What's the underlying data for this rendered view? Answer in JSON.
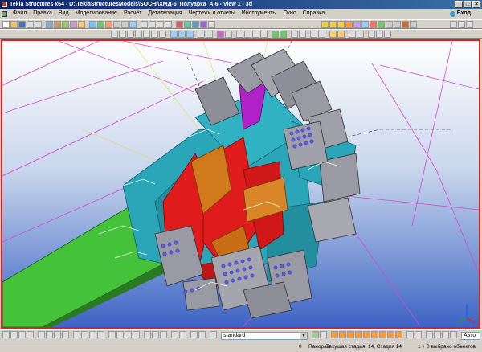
{
  "window": {
    "title": "Tekla Structures x64 - D:\\TeklaStructuresModels\\SOCHI\\ХМД-6_Полуарка_А-6 - View 1 - 3d",
    "controls": [
      "_",
      "□",
      "×"
    ]
  },
  "menu": {
    "items": [
      "Файл",
      "Правка",
      "Вид",
      "Моделирование",
      "Расчёт",
      "Детализация",
      "Чертежи и отчеты",
      "Инструменты",
      "Окно",
      "Справка"
    ],
    "login_label": "Вход"
  },
  "bottom_toolbar": {
    "standard_select": "standard",
    "snap_mode": "Авто"
  },
  "statusbar": {
    "counter": "0",
    "mode": "Панорам",
    "phase": "Текущая стадия: 14, Стадия 14",
    "selection": "1 + 0 выбрано объектов"
  },
  "colors": {
    "viewport_border": "#e02020",
    "title_gradient_start": "#0a246a",
    "title_gradient_end": "#3a6ea5",
    "beam_green": "#44c23a",
    "plate_cyan": "#2aa6b8",
    "plate_red": "#e01b1b",
    "plate_orange": "#d07a1c",
    "plate_gray": "#9a9aa4",
    "plate_magenta": "#b021c8",
    "bolt_blue": "#5a5af0"
  }
}
